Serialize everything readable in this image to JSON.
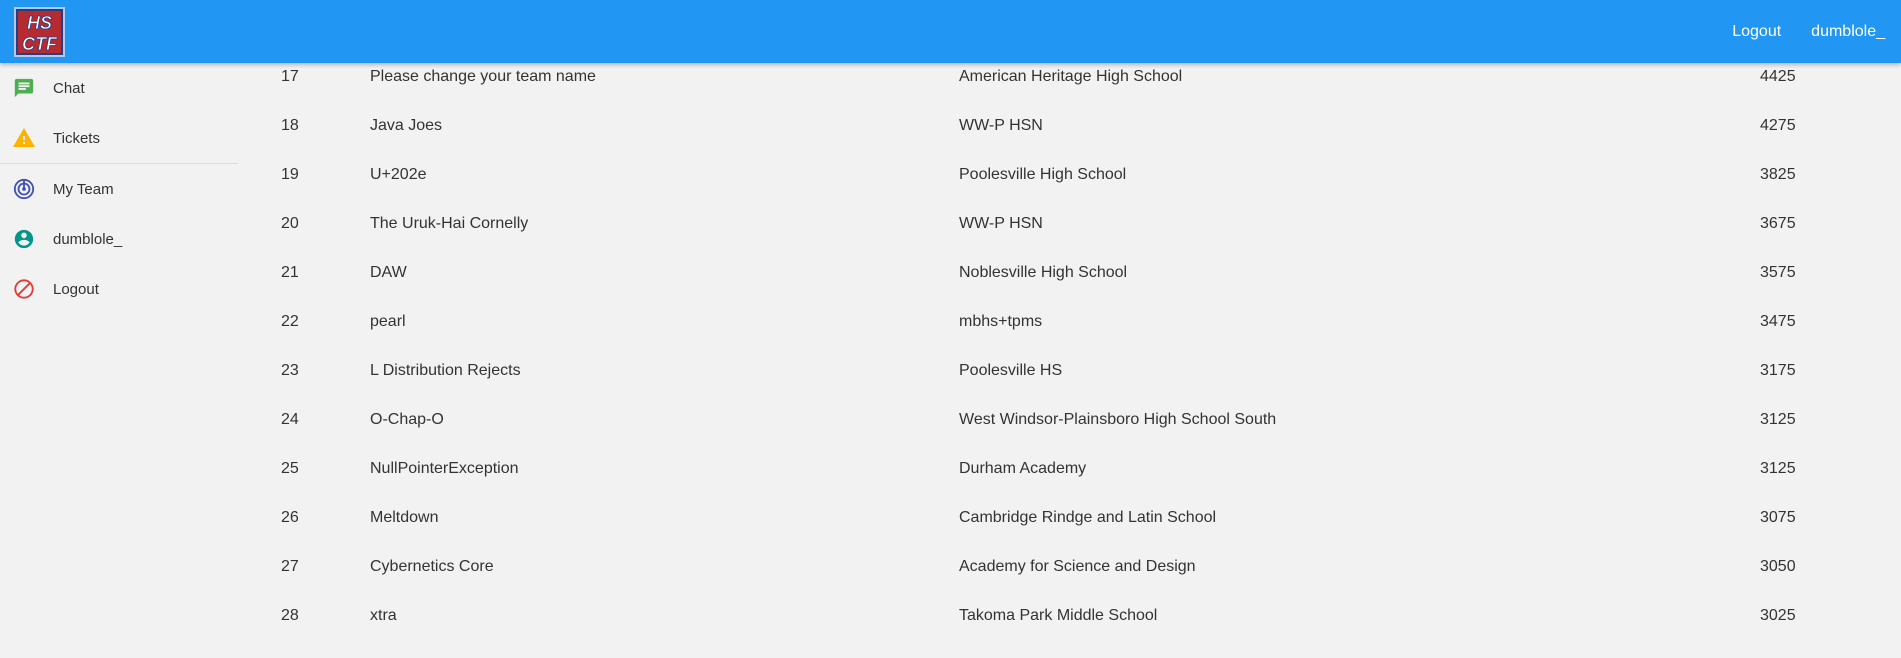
{
  "header": {
    "logo_text": "HS CTF",
    "logout_label": "Logout",
    "username": "dumblole_"
  },
  "sidebar": {
    "items": [
      {
        "label": "Chat",
        "icon": "chat-icon",
        "color": "#4caf50"
      },
      {
        "label": "Tickets",
        "icon": "warning-icon",
        "color": "#ffb300"
      },
      {
        "label": "My Team",
        "icon": "radar-icon",
        "color": "#3f51b5"
      },
      {
        "label": "dumblole_",
        "icon": "account-circle-icon",
        "color": "#009688"
      },
      {
        "label": "Logout",
        "icon": "block-icon",
        "color": "#e53935"
      }
    ]
  },
  "scoreboard": {
    "rows": [
      {
        "rank": "17",
        "team": "Please change your team name",
        "school": "American Heritage High School",
        "score": "4425"
      },
      {
        "rank": "18",
        "team": "Java Joes",
        "school": "WW-P HSN",
        "score": "4275"
      },
      {
        "rank": "19",
        "team": "U+202e",
        "school": "Poolesville High School",
        "score": "3825"
      },
      {
        "rank": "20",
        "team": "The Uruk-Hai Cornelly",
        "school": "WW-P HSN",
        "score": "3675"
      },
      {
        "rank": "21",
        "team": "DAW",
        "school": "Noblesville High School",
        "score": "3575"
      },
      {
        "rank": "22",
        "team": "pearl",
        "school": "mbhs+tpms",
        "score": "3475"
      },
      {
        "rank": "23",
        "team": "L Distribution Rejects",
        "school": "Poolesville HS",
        "score": "3175"
      },
      {
        "rank": "24",
        "team": "O-Chap-O",
        "school": "West Windsor-Plainsboro High School South",
        "score": "3125"
      },
      {
        "rank": "25",
        "team": "NullPointerException",
        "school": "Durham Academy",
        "score": "3125"
      },
      {
        "rank": "26",
        "team": "Meltdown",
        "school": "Cambridge Rindge and Latin School",
        "score": "3075"
      },
      {
        "rank": "27",
        "team": "Cybernetics Core",
        "school": "Academy for Science and Design",
        "score": "3050"
      },
      {
        "rank": "28",
        "team": "xtra",
        "school": "Takoma Park Middle School",
        "score": "3025"
      }
    ]
  },
  "colors": {
    "header": "#2196f3",
    "background": "#f2f2f2"
  }
}
